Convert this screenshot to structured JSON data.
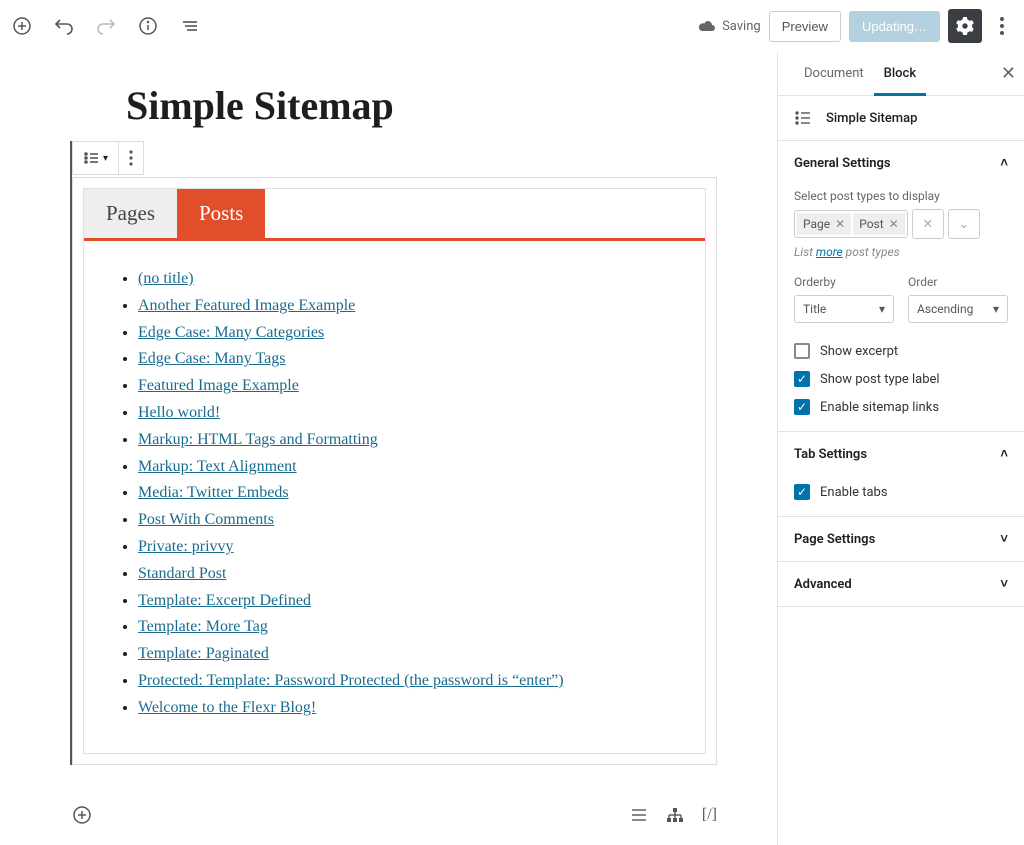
{
  "toolbar": {
    "saving_label": "Saving",
    "preview_label": "Preview",
    "update_label": "Updating…"
  },
  "page": {
    "title": "Simple Sitemap"
  },
  "sitemap": {
    "tabs": [
      {
        "label": "Pages"
      },
      {
        "label": "Posts"
      }
    ],
    "active_tab": 1,
    "posts": [
      "(no title)",
      "Another Featured Image Example",
      "Edge Case: Many Categories",
      "Edge Case: Many Tags",
      "Featured Image Example",
      "Hello world!",
      "Markup: HTML Tags and Formatting",
      "Markup: Text Alignment",
      "Media: Twitter Embeds",
      "Post With Comments",
      "Private: privvy",
      "Standard Post",
      "Template: Excerpt Defined",
      "Template: More Tag",
      "Template: Paginated",
      "Protected: Template: Password Protected (the password is “enter”)",
      "Welcome to the Flexr Blog!"
    ]
  },
  "bottom": {
    "shortcode": "[/]"
  },
  "sidebar": {
    "tabs": {
      "document": "Document",
      "block": "Block"
    },
    "block_name": "Simple Sitemap",
    "panels": {
      "general": {
        "title": "General Settings",
        "post_types_label": "Select post types to display",
        "post_types": [
          "Page",
          "Post"
        ],
        "hint_prefix": "List ",
        "hint_link": "more",
        "hint_suffix": " post types",
        "orderby_label": "Orderby",
        "orderby_value": "Title",
        "order_label": "Order",
        "order_value": "Ascending",
        "show_excerpt_label": "Show excerpt",
        "show_excerpt": false,
        "show_post_type_label_label": "Show post type label",
        "show_post_type_label": true,
        "enable_links_label": "Enable sitemap links",
        "enable_links": true
      },
      "tab_settings": {
        "title": "Tab Settings",
        "enable_tabs_label": "Enable tabs",
        "enable_tabs": true
      },
      "page_settings": {
        "title": "Page Settings"
      },
      "advanced": {
        "title": "Advanced"
      }
    }
  }
}
